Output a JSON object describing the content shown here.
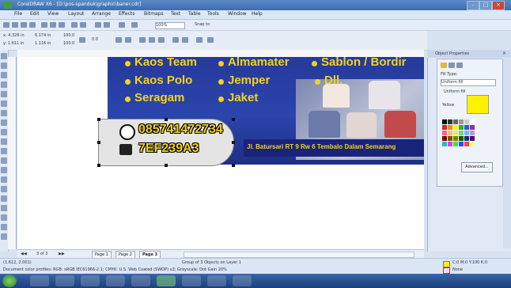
{
  "window": {
    "title": "CorelDRAW X6 - [D:\\pos-spanduk\\graphic\\baner.cdr]",
    "controls": [
      "–",
      "□",
      "×"
    ]
  },
  "menubar": {
    "items": [
      "File",
      "Edit",
      "View",
      "Layout",
      "Arrange",
      "Effects",
      "Bitmaps",
      "Text",
      "Table",
      "Tools",
      "Window",
      "Help"
    ]
  },
  "toolbar": {
    "zoom": "100%",
    "snap": "Snap to"
  },
  "property_bar": {
    "x": "x: 4.326 in",
    "y": "y: 1.611 in",
    "w": "6.174 in",
    "h": "1.116 in",
    "scale_w": "100.0",
    "scale_h": "100.0",
    "angle": "0.0"
  },
  "banner": {
    "row1": [
      "Kaos Team",
      "Almamater",
      "Sablon / Bordir"
    ],
    "row2": [
      "Kaos Polo",
      "Jemper",
      "Dll."
    ],
    "row3": [
      "Seragam",
      "Jaket"
    ],
    "phone": "085741472734",
    "pin": "7EF239A3",
    "address": "Jl. Batursari RT 9 Rw 6 Tembalo Dalam Semarang"
  },
  "docker": {
    "title": "Object Properties",
    "fill_type_label": "Fill Type:",
    "fill_type_value": "Uniform fill",
    "fill_name": "Uniform fill",
    "color_label": "Yellow",
    "advanced_label": "Advanced...",
    "fill_color": "#fff200"
  },
  "pagebar": {
    "pages_count": "3 of 3",
    "tabs": [
      "Page 1",
      "Page 2",
      "Page 3"
    ]
  },
  "status": {
    "coords": "(1.612, 2.001)",
    "selection": "Group of 3 Objects on Layer 1",
    "profiles": "Document color profiles: RGB: sRGB IEC61966-2.1; CMYK: U.S. Web Coated (SWOP) v2; Grayscale: Dot Gain 20%",
    "fill_status": "C:0 M:0 Y:100 K:0",
    "outline_status": "None"
  }
}
